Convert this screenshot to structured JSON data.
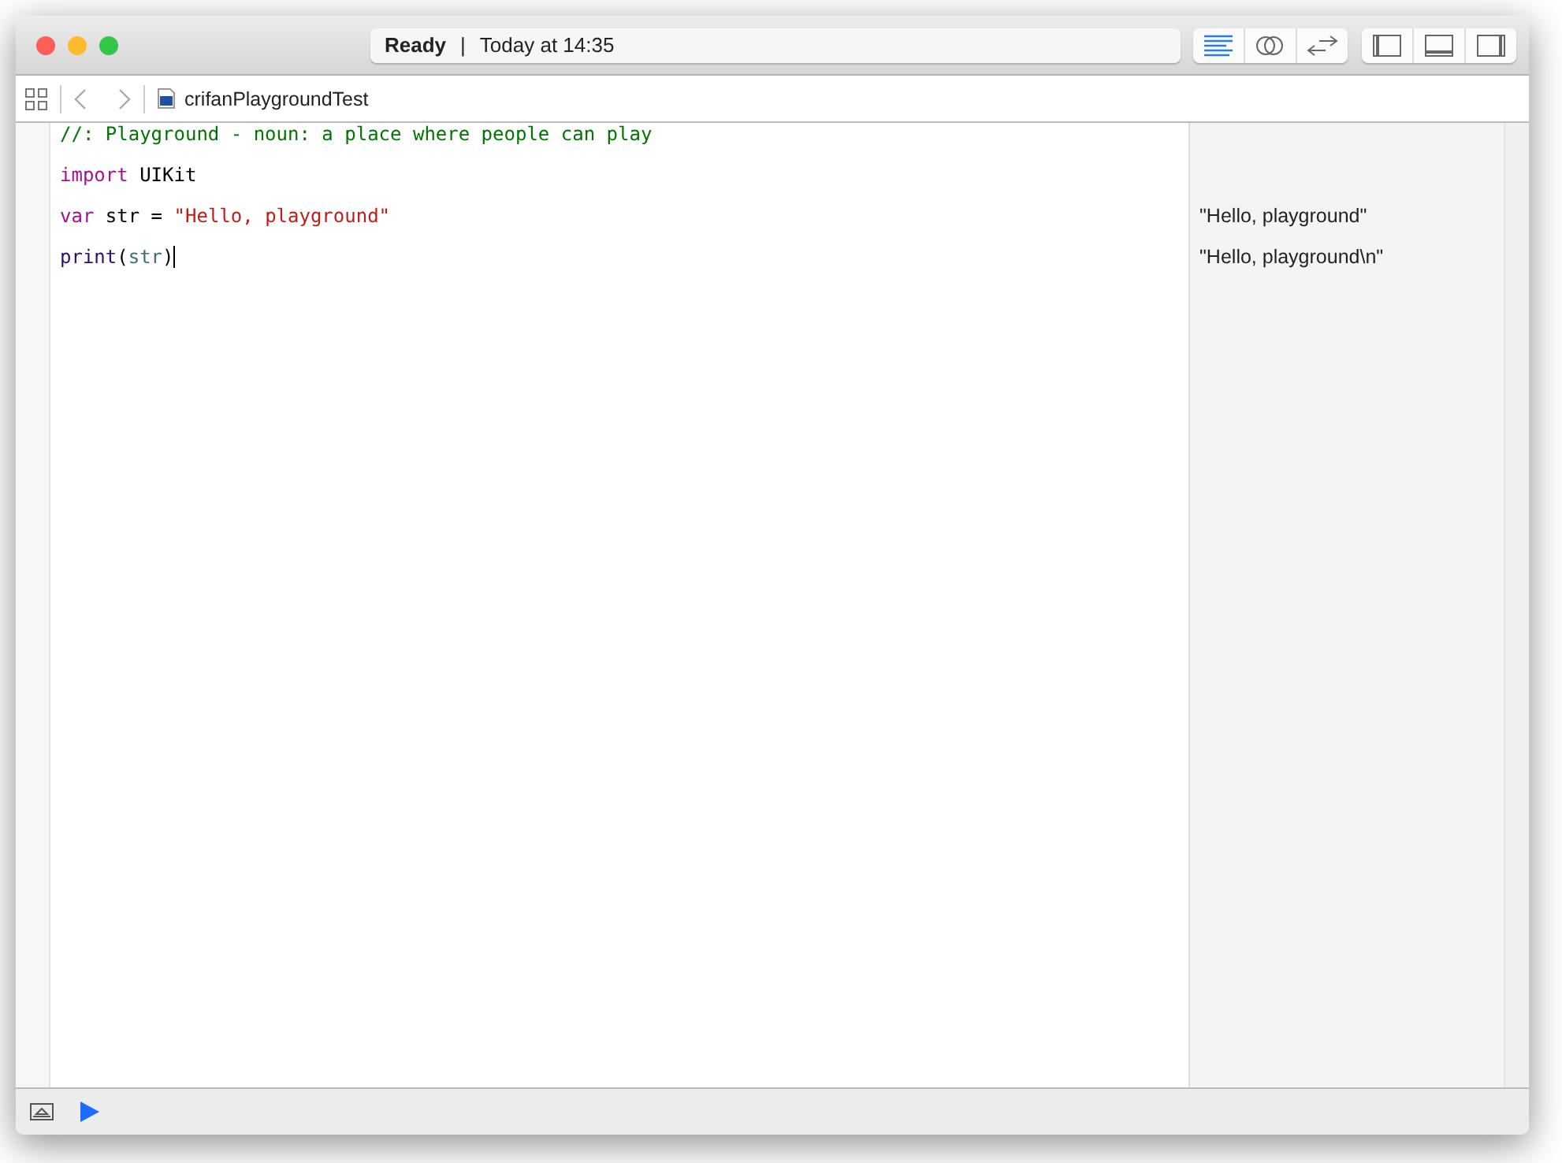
{
  "window": {
    "title_status": "Ready",
    "title_separator": "|",
    "title_time": "Today at 14:35"
  },
  "editor_modes": [
    {
      "kind": "standard",
      "selected": true
    },
    {
      "kind": "assistant",
      "selected": false
    },
    {
      "kind": "version",
      "selected": false
    }
  ],
  "panels": [
    {
      "kind": "left",
      "selected": false
    },
    {
      "kind": "bottom",
      "selected": false
    },
    {
      "kind": "right",
      "selected": false
    }
  ],
  "breadcrumb": {
    "file": "crifanPlaygroundTest"
  },
  "code_lines": [
    {
      "tokens": [
        {
          "kind": "comment",
          "text": "//: Playground - noun: a place where people can play"
        }
      ],
      "cursor": false
    },
    {
      "tokens": [
        {
          "kind": "keyword",
          "text": "import"
        },
        {
          "kind": "plain",
          "text": " UIKit"
        }
      ],
      "cursor": false
    },
    {
      "tokens": [
        {
          "kind": "keyword",
          "text": "var"
        },
        {
          "kind": "plain",
          "text": " str = "
        },
        {
          "kind": "string",
          "text": "\"Hello, playground\""
        }
      ],
      "result": "\"Hello, playground\"",
      "cursor": false
    },
    {
      "tokens": [
        {
          "kind": "func",
          "text": "print"
        },
        {
          "kind": "plain",
          "text": "("
        },
        {
          "kind": "ident",
          "text": "str"
        },
        {
          "kind": "plain",
          "text": ")"
        }
      ],
      "result": "\"Hello, playground\\n\"",
      "cursor": true
    }
  ]
}
